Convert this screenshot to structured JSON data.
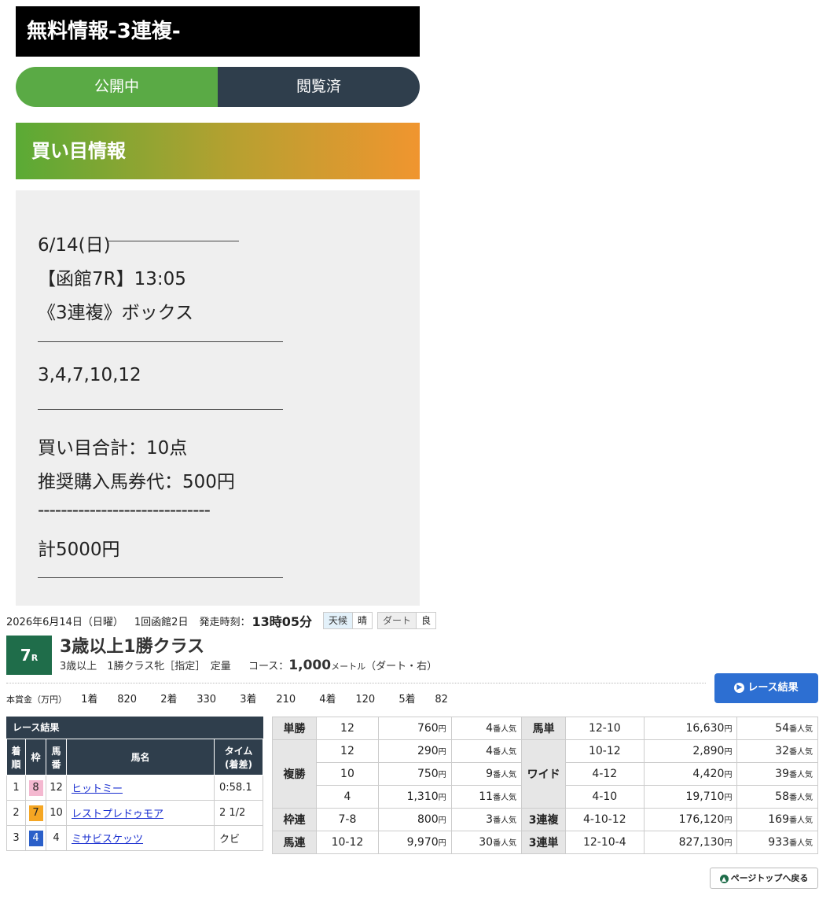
{
  "title": "無料情報-3連複-",
  "toggle": {
    "open_label": "公開中",
    "viewed_label": "閲覧済"
  },
  "buy_header": "買い目情報",
  "info": {
    "date": "6/14(日)",
    "race": "【函館7R】13:05",
    "bet_type": "《3連複》ボックス",
    "numbers": "3,4,7,10,12",
    "total_points": "買い目合計：10点",
    "unit_price": "推奨購入馬券代：500円",
    "dashes": "------------------------------",
    "total": "計5000円"
  },
  "race_meta": {
    "date": "2026年6月14日（日曜）",
    "meeting": "1回函館2日",
    "start_label": "発走時刻：",
    "start_time": "13時05分",
    "weather_label": "天候",
    "weather": "晴",
    "track_label": "ダート",
    "track_cond": "良"
  },
  "race": {
    "number": "7",
    "number_suffix": "R",
    "name": "3歳以上1勝クラス",
    "cond1": "3歳以上　1勝クラス牝［指定］　定量",
    "course_label": "コース：",
    "distance": "1,000",
    "unit": "メートル",
    "surface": "（ダート・右）"
  },
  "prize": {
    "label": "本賞金（万円）",
    "items": [
      {
        "rank": "1着",
        "value": "820"
      },
      {
        "rank": "2着",
        "value": "330"
      },
      {
        "rank": "3着",
        "value": "210"
      },
      {
        "rank": "4着",
        "value": "120"
      },
      {
        "rank": "5着",
        "value": "82"
      }
    ]
  },
  "result_button": "レース結果",
  "results": {
    "caption": "レース結果",
    "headers": {
      "rank": "着順",
      "waku": "枠",
      "num": "馬番",
      "name": "馬名",
      "time": "タイム(着差)"
    },
    "rows": [
      {
        "rank": "1",
        "waku": "8",
        "waku_color": "#f4b8d0",
        "num": "12",
        "name": "ヒットミー",
        "time": "0:58.1"
      },
      {
        "rank": "2",
        "waku": "7",
        "waku_color": "#f5a623",
        "num": "10",
        "name": "レストプレドゥモア",
        "time": "2 1/2"
      },
      {
        "rank": "3",
        "waku": "4",
        "waku_color": "#2a5fc9",
        "num": "4",
        "name": "ミサビスケッツ",
        "time": "クビ"
      }
    ]
  },
  "payouts": {
    "yen": "円",
    "pop_suffix": "番人気",
    "tansho": {
      "label": "単勝",
      "combo": "12",
      "amount": "760",
      "pop": "4"
    },
    "umatan": {
      "label": "馬単",
      "combo": "12-10",
      "amount": "16,630",
      "pop": "54"
    },
    "fukusho_label": "複勝",
    "fukusho": [
      {
        "combo": "12",
        "amount": "290",
        "pop": "4"
      },
      {
        "combo": "10",
        "amount": "750",
        "pop": "9"
      },
      {
        "combo": "4",
        "amount": "1,310",
        "pop": "11"
      }
    ],
    "wide_label": "ワイド",
    "wide": [
      {
        "combo": "10-12",
        "amount": "2,890",
        "pop": "32"
      },
      {
        "combo": "4-12",
        "amount": "4,420",
        "pop": "39"
      },
      {
        "combo": "4-10",
        "amount": "19,710",
        "pop": "58"
      }
    ],
    "wakuren": {
      "label": "枠連",
      "combo": "7-8",
      "amount": "800",
      "pop": "3"
    },
    "sanrenpuku": {
      "label": "3連複",
      "combo": "4-10-12",
      "amount": "176,120",
      "pop": "169"
    },
    "umaren": {
      "label": "馬連",
      "combo": "10-12",
      "amount": "9,970",
      "pop": "30"
    },
    "sanrentan": {
      "label": "3連単",
      "combo": "12-10-4",
      "amount": "827,130",
      "pop": "933"
    }
  },
  "page_top": "ページトップへ戻る"
}
